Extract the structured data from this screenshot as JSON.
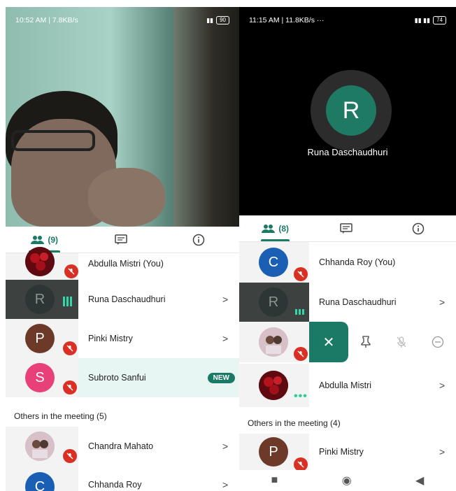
{
  "left": {
    "status": {
      "time": "10:52 AM | 7.8KB/s",
      "battery": "90"
    },
    "tabs": {
      "people_count": "(9)"
    },
    "participants": [
      {
        "name": "Abdulla Mistri (You)",
        "avatar": ""
      },
      {
        "name": "Runa Daschaudhuri",
        "avatar": "R"
      },
      {
        "name": "Pinki Mistry",
        "avatar": "P"
      },
      {
        "name": "Subroto Sanfui",
        "avatar": "S",
        "badge": "NEW"
      }
    ],
    "others_title": "Others in the meeting (5)",
    "others": [
      {
        "name": "Chandra Mahato",
        "avatar": ""
      },
      {
        "name": "Chhanda Roy",
        "avatar": "C"
      }
    ]
  },
  "right": {
    "status": {
      "time": "11:15 AM | 11.8KB/s",
      "extra": "···",
      "battery": "74"
    },
    "speaker": {
      "initial": "R",
      "name": "Runa Daschaudhuri"
    },
    "tabs": {
      "people_count": "(8)"
    },
    "participants": [
      {
        "name": "Chhanda Roy (You)",
        "avatar": "C"
      },
      {
        "name": "Runa Daschaudhuri",
        "avatar": "R"
      },
      {
        "name": "",
        "avatar": ""
      },
      {
        "name": "Abdulla Mistri",
        "avatar": ""
      }
    ],
    "others_title": "Others in the meeting (4)",
    "others": [
      {
        "name": "Pinki Mistry",
        "avatar": "P"
      }
    ]
  },
  "colors": {
    "accent": "#1a7a66",
    "mute": "#d93025"
  }
}
